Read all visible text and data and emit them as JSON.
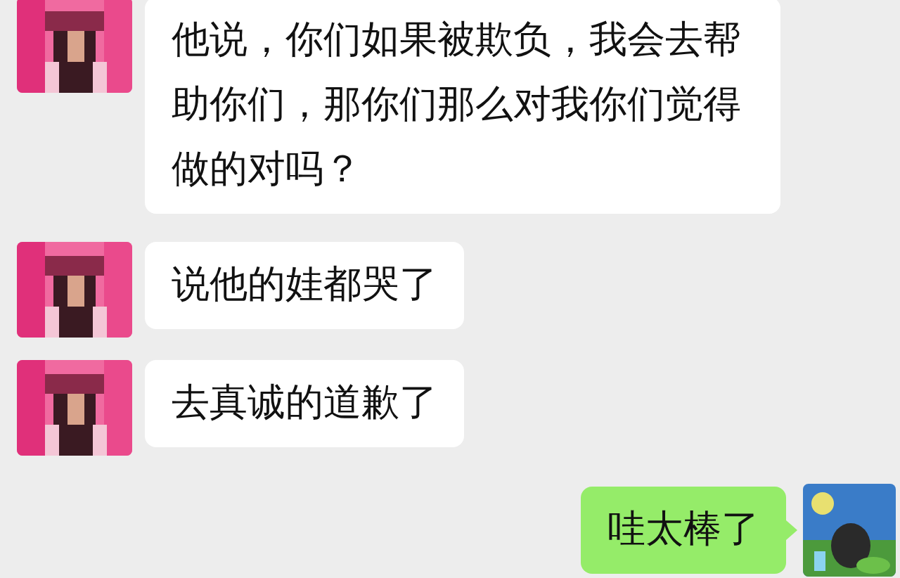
{
  "messages": [
    {
      "kind": "incoming",
      "text": "他说，你们如果被欺负，我会去帮助你们，那你们那么对我你们觉得做的对吗？"
    },
    {
      "kind": "incoming",
      "text": "说他的娃都哭了"
    },
    {
      "kind": "incoming",
      "text": "去真诚的道歉了"
    },
    {
      "kind": "outgoing",
      "text": "哇太棒了"
    }
  ]
}
